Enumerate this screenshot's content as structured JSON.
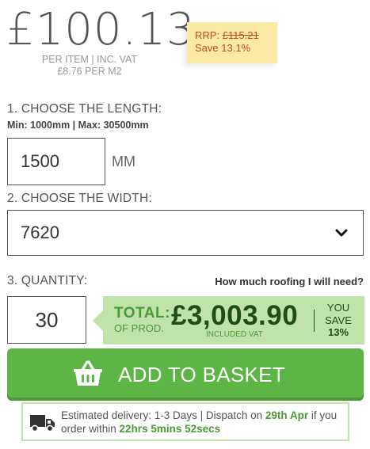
{
  "price": {
    "main": "£100.13",
    "per_item": "PER ITEM | INC. VAT",
    "per_m2": "£8.76 PER M2"
  },
  "rrp": {
    "label": "RRP:",
    "value": "£115.21",
    "save": "Save 13.1%"
  },
  "length": {
    "label": "1. CHOOSE THE LENGTH:",
    "hint": "Min: 1000mm | Max: 30500mm",
    "value": "1500",
    "unit": "MM"
  },
  "width": {
    "label": "2. CHOOSE THE WIDTH:",
    "selected": "7620"
  },
  "quantity": {
    "label": "3. QUANTITY:",
    "value": "30",
    "help_link": "How much roofing I will need?"
  },
  "total": {
    "label": "TOTAL:",
    "sub": "OF PROD.",
    "amount": "£3,003.90",
    "vat": "INCLUDED VAT",
    "save_label": "YOU SAVE",
    "save_pct": "13%"
  },
  "basket": {
    "label": "ADD TO BASKET"
  },
  "delivery": {
    "prefix": "Estimated delivery: 1-3 Days | Dispatch on",
    "dispatch_date": "29th Apr",
    "middle": "if you order within",
    "countdown": "22hrs 5mins 52secs"
  },
  "colors": {
    "accent_green": "#5cb544",
    "dark_green": "#1f4d16",
    "light_green": "#bfe3a8",
    "rrp_bg": "#fbeaa5",
    "rrp_text": "#c24a1a"
  },
  "icons": {
    "chevron": "chevron-down-icon",
    "basket": "basket-icon",
    "truck": "truck-icon"
  }
}
